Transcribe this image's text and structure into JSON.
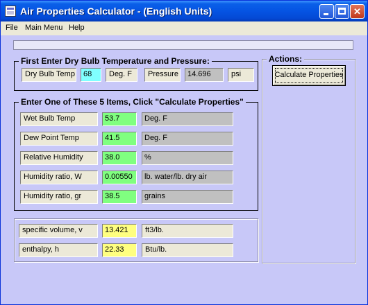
{
  "window": {
    "title": "Air Properties Calculator - (English Units)"
  },
  "menu": [
    "File",
    "Main Menu",
    "Help"
  ],
  "section1": {
    "legend": "First Enter Dry Bulb Temperature and Pressure:",
    "dry_bulb": {
      "label": "Dry Bulb Temp",
      "value": "68",
      "unit": "Deg. F"
    },
    "pressure": {
      "label": "Pressure",
      "value": "14.696",
      "unit": "psi"
    }
  },
  "section2": {
    "legend": "Enter One of These 5 Items, Click \"Calculate Properties\"",
    "rows": [
      {
        "label": "Wet Bulb Temp",
        "value": "53.7",
        "unit": "Deg. F"
      },
      {
        "label": "Dew Point Temp",
        "value": "41.5",
        "unit": "Deg. F"
      },
      {
        "label": "Relative Humidity",
        "value": "38.0",
        "unit": "%"
      },
      {
        "label": "Humidity ratio, W",
        "value": "0.00550",
        "unit": "lb. water/lb. dry air"
      },
      {
        "label": "Humidity ratio, gr",
        "value": "38.5",
        "unit": "grains"
      }
    ]
  },
  "section3": {
    "rows": [
      {
        "label": "specific volume, v",
        "value": "13.421",
        "unit": "ft3/lb."
      },
      {
        "label": "enthalpy, h",
        "value": "22.33",
        "unit": "Btu/lb."
      }
    ]
  },
  "actions": {
    "legend": "Actions:",
    "calculate_label": "Calculate Properties"
  },
  "colors": {
    "window_bg": "#c8c8f8",
    "input_green": "#80ff80",
    "input_cyan": "#80ffff",
    "output_yellow": "#ffff80"
  }
}
